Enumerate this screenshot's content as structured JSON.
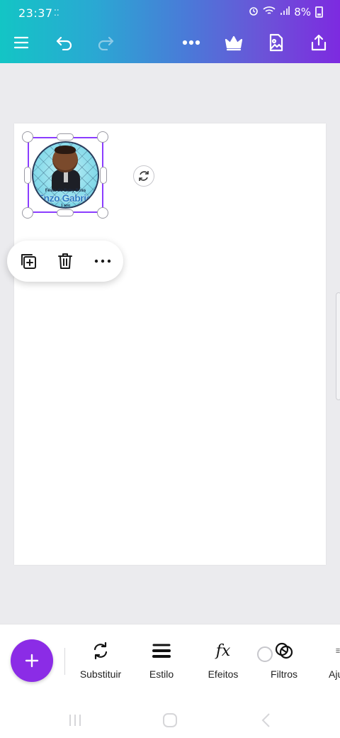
{
  "status_bar": {
    "time": "23:37",
    "notifications": "⁚⁚",
    "battery": "8%"
  },
  "toolbar": {
    "menu": "menu-icon",
    "undo": "undo-icon",
    "redo": "redo-icon",
    "more": "more-icon",
    "premium": "crown-icon",
    "download": "image-file-icon",
    "share": "share-icon"
  },
  "sticker": {
    "line1": "Festa do Baby Boss",
    "name": "Enzo Gabriel",
    "line3": "1 ano"
  },
  "context_menu": {
    "copy": "copy-icon",
    "delete": "trash-icon",
    "more": "more-icon"
  },
  "bottom_tools": [
    {
      "label": "Substituir",
      "icon": "replace-icon"
    },
    {
      "label": "Estilo",
      "icon": "style-icon"
    },
    {
      "label": "Efeitos",
      "icon": "fx-icon"
    },
    {
      "label": "Filtros",
      "icon": "filters-icon"
    },
    {
      "label": "Aju",
      "icon": "adjust-icon"
    }
  ],
  "colors": {
    "accent": "#8b3dff",
    "fab": "#8b2ce6",
    "gradient_start": "#13c5c5",
    "gradient_end": "#7d2ae0"
  }
}
